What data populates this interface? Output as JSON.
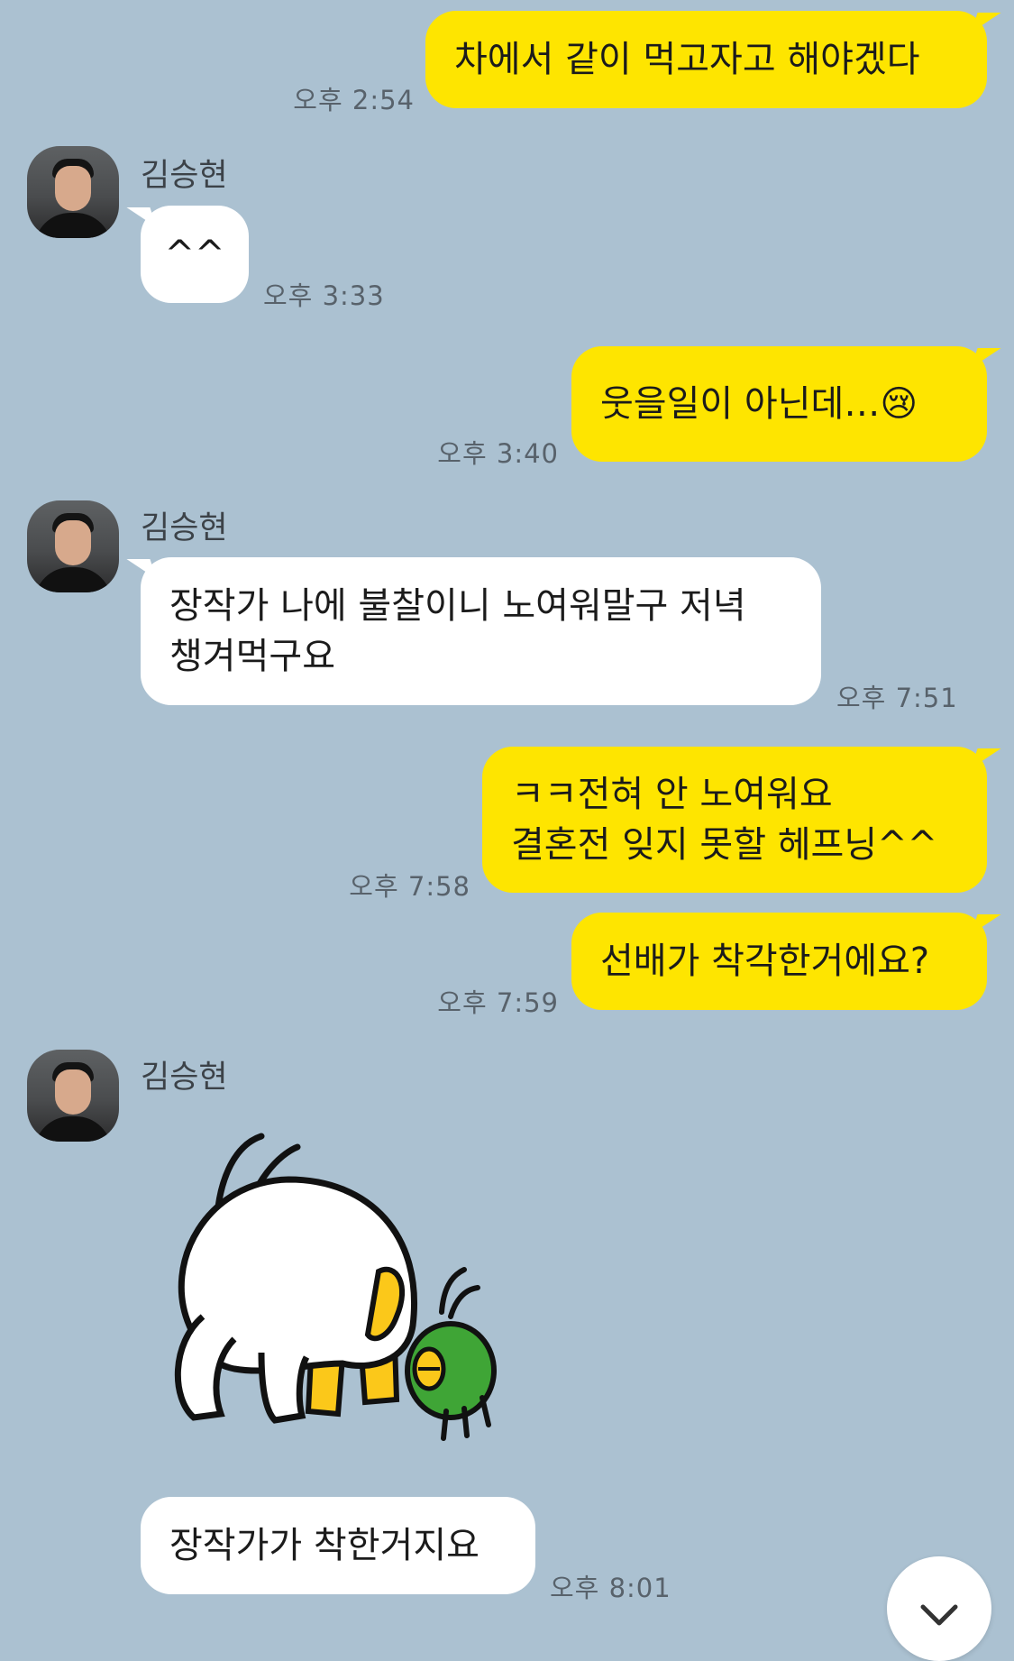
{
  "sender_name": "김승현",
  "messages": [
    {
      "id": "m1",
      "from": "me",
      "lines": [
        "차에서 같이 먹고자고 해야겠다"
      ],
      "time": "오후 2:54"
    },
    {
      "id": "m2",
      "from": "them",
      "lines": [
        "^^"
      ],
      "time": "오후 3:33"
    },
    {
      "id": "m3",
      "from": "me",
      "lines": [
        "웃을일이 아닌데…😢"
      ],
      "time": "오후 3:40"
    },
    {
      "id": "m4",
      "from": "them",
      "lines": [
        "장작가 나에 불찰이니 노여워말구 저녁",
        "챙겨먹구요"
      ],
      "time": "오후 7:51"
    },
    {
      "id": "m5",
      "from": "me",
      "lines": [
        "ㅋㅋ전혀 안 노여워요",
        "결혼전 잊지 못할 헤프닝^^"
      ],
      "time": "오후 7:58"
    },
    {
      "id": "m6",
      "from": "me",
      "lines": [
        "선배가 착각한거에요?"
      ],
      "time": "오후 7:59"
    },
    {
      "id": "m7",
      "from": "them",
      "sticker": "white-creature-and-green-alien-sticker"
    },
    {
      "id": "m8",
      "from": "them",
      "lines": [
        "장작가가 착한거지요"
      ],
      "time": "오후 8:01"
    }
  ],
  "icons": {
    "avatar": "profile-photo",
    "scroll_down": "chevron-down-icon"
  },
  "colors": {
    "background": "#abc1d1",
    "my_bubble": "#fee500",
    "their_bubble": "#ffffff"
  }
}
